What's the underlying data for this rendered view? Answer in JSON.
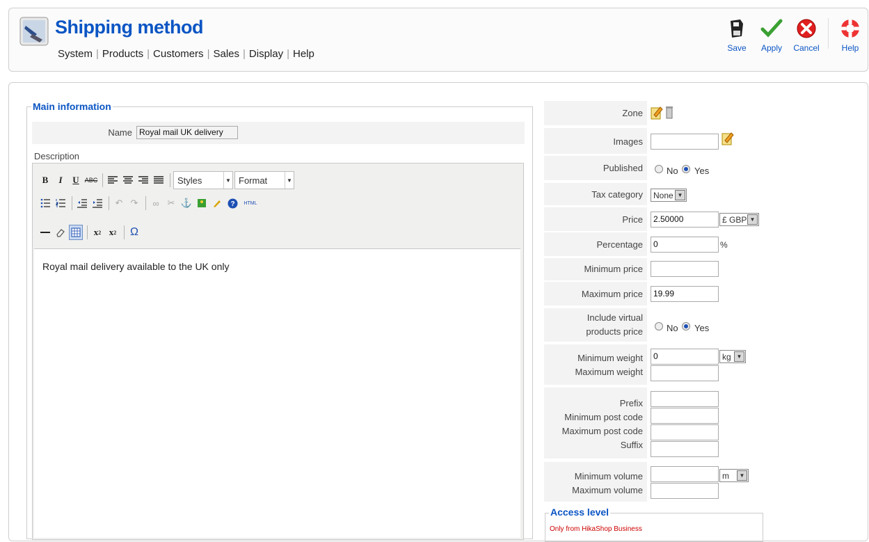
{
  "header": {
    "title": "Shipping method",
    "menu": [
      "System",
      "Products",
      "Customers",
      "Sales",
      "Display",
      "Help"
    ],
    "toolbar": {
      "save": "Save",
      "apply": "Apply",
      "cancel": "Cancel",
      "help": "Help"
    }
  },
  "main": {
    "legend": "Main information",
    "name_label": "Name",
    "name_value": "Royal mail UK delivery",
    "description_label": "Description",
    "editor": {
      "styles": "Styles",
      "format": "Format",
      "content": "Royal mail delivery available to the UK only"
    }
  },
  "side": {
    "zone_label": "Zone",
    "images_label": "Images",
    "published_label": "Published",
    "no": "No",
    "yes": "Yes",
    "published_value": "Yes",
    "tax_label": "Tax category",
    "tax_value": "None",
    "price_label": "Price",
    "price_value": "2.50000",
    "currency": "£ GBP",
    "percentage_label": "Percentage",
    "percentage_value": "0",
    "percent_sign": "%",
    "min_price_label": "Minimum price",
    "min_price_value": "",
    "max_price_label": "Maximum price",
    "max_price_value": "19.99",
    "include_virtual_label_1": "Include virtual",
    "include_virtual_label_2": "products price",
    "include_virtual_value": "Yes",
    "min_weight_label": "Minimum weight",
    "min_weight_value": "0",
    "weight_unit": "kg",
    "max_weight_label": "Maximum weight",
    "max_weight_value": "",
    "prefix_label": "Prefix",
    "min_post_label": "Minimum post code",
    "max_post_label": "Maximum post code",
    "suffix_label": "Suffix",
    "min_volume_label": "Minimum volume",
    "volume_unit": "m",
    "max_volume_label": "Maximum volume"
  },
  "access": {
    "legend": "Access level",
    "note": "Only from HikaShop Business"
  },
  "colors": {
    "title_blue": "#0b55c4",
    "label_bg": "#f3f3f3",
    "note_red": "#cc0000"
  }
}
